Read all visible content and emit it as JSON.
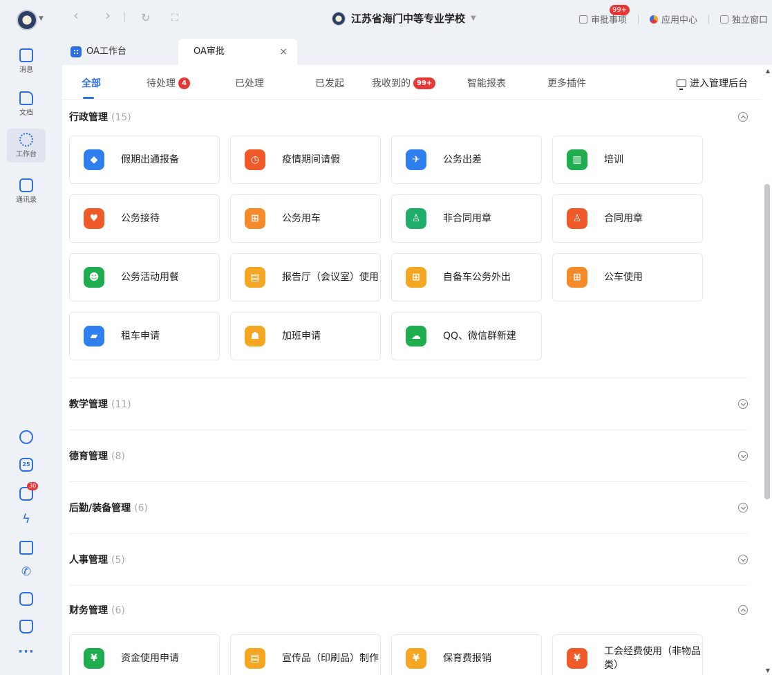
{
  "rail": {
    "items": [
      {
        "label": "消息"
      },
      {
        "label": "文档"
      },
      {
        "label": "工作台"
      },
      {
        "label": "通讯录"
      }
    ],
    "calendar_day": "25",
    "task_badge": "30",
    "more": "···"
  },
  "topbar": {
    "back": "‹",
    "forward": "›",
    "refresh": "↻",
    "fullscreen": "⛶",
    "org_name": "江苏省海门中等专业学校",
    "approval_label": "审批事项",
    "approval_badge": "99+",
    "app_center": "应用中心",
    "standalone": "独立窗口"
  },
  "tabs": [
    {
      "label": "OA工作台"
    },
    {
      "label": "OA审批",
      "close": "×"
    }
  ],
  "subnav": {
    "items": [
      {
        "label": "全部"
      },
      {
        "label": "待处理",
        "badge": "4"
      },
      {
        "label": "已处理"
      },
      {
        "label": "已发起"
      },
      {
        "label": "我收到的",
        "badge": "99+"
      },
      {
        "label": "智能报表"
      },
      {
        "label": "更多插件"
      }
    ],
    "admin": "进入管理后台"
  },
  "sections": [
    {
      "title": "行政管理",
      "count": "(15)",
      "state": "expanded",
      "cards": [
        {
          "label": "假期出通报备",
          "color": "#2f7ff0",
          "glyph": "◆"
        },
        {
          "label": "疫情期间请假",
          "color": "#f05a28",
          "glyph": "◷"
        },
        {
          "label": "公务出差",
          "color": "#2f7ff0",
          "glyph": "✈"
        },
        {
          "label": "培训",
          "color": "#1fae4f",
          "glyph": "▥"
        },
        {
          "label": "公务接待",
          "color": "#f05a28",
          "glyph": "♥"
        },
        {
          "label": "公务用车",
          "color": "#f58a2a",
          "glyph": "⊞"
        },
        {
          "label": "非合同用章",
          "color": "#1fae6a",
          "glyph": "♙"
        },
        {
          "label": "合同用章",
          "color": "#f05a28",
          "glyph": "♙"
        },
        {
          "label": "公务活动用餐",
          "color": "#1fae4f",
          "glyph": "☻"
        },
        {
          "label": "报告厅（会议室）使用",
          "color": "#f5a623",
          "glyph": "▤"
        },
        {
          "label": "自备车公务外出",
          "color": "#f5a623",
          "glyph": "⊞"
        },
        {
          "label": "公车使用",
          "color": "#f58a2a",
          "glyph": "⊞"
        },
        {
          "label": "租车申请",
          "color": "#2f7ff0",
          "glyph": "▰"
        },
        {
          "label": "加班申请",
          "color": "#f5a623",
          "glyph": "☗"
        },
        {
          "label": "QQ、微信群新建",
          "color": "#1fae4f",
          "glyph": "☁"
        }
      ]
    },
    {
      "title": "教学管理",
      "count": "(11)",
      "state": "collapsed"
    },
    {
      "title": "德育管理",
      "count": "(8)",
      "state": "collapsed"
    },
    {
      "title": "后勤/装备管理",
      "count": "(6)",
      "state": "collapsed"
    },
    {
      "title": "人事管理",
      "count": "(5)",
      "state": "collapsed"
    },
    {
      "title": "财务管理",
      "count": "(6)",
      "state": "expanded",
      "cards": [
        {
          "label": "资金使用申请",
          "color": "#1fae4f",
          "glyph": "¥"
        },
        {
          "label": "宣传品（印刷品）制作",
          "color": "#f5a623",
          "glyph": "▤"
        },
        {
          "label": "保育费报销",
          "color": "#f5a623",
          "glyph": "¥"
        },
        {
          "label": "工会经费使用（非物品类）",
          "color": "#f05a28",
          "glyph": "¥"
        }
      ]
    }
  ]
}
